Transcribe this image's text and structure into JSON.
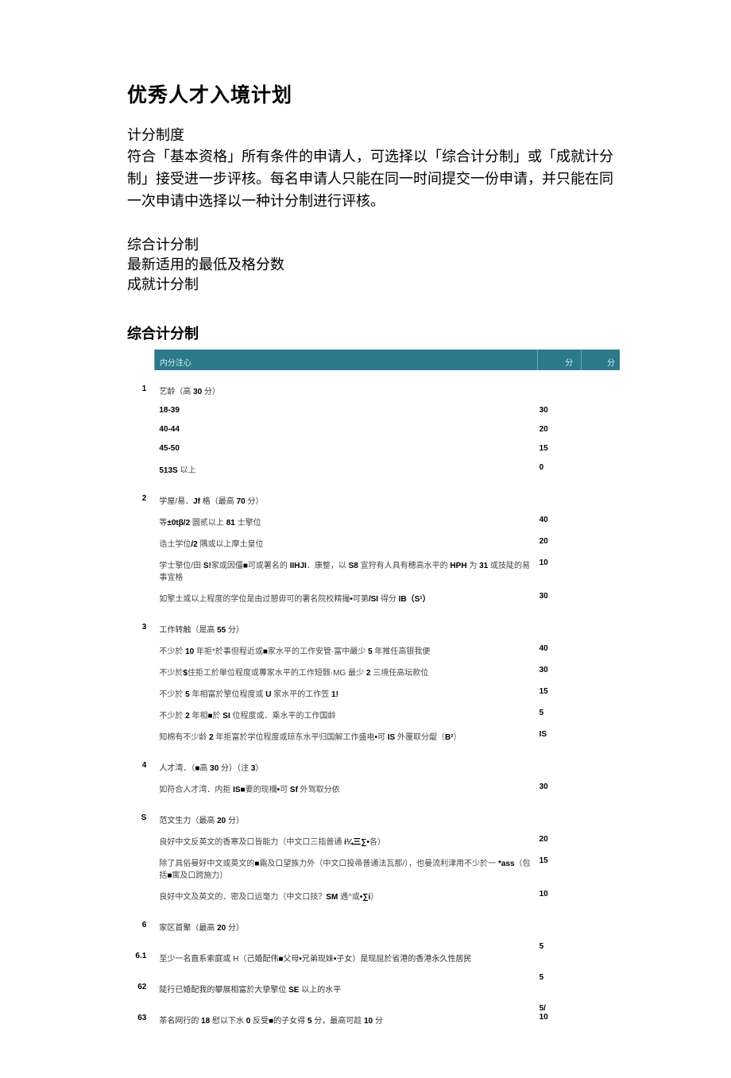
{
  "title": "优秀人才入境计划",
  "subtitle": "计分制度",
  "intro": "符合「基本资格」所有条件的申请人，可选择以「综合计分制」或「成就计分制」接受进一步评核。每名申请人只能在同一时间提交一份申请，并只能在同一次申请中选择以一种计分制进行评核。",
  "links": {
    "l1": "综合计分制",
    "l2": "最新适用的最低及格分数",
    "l3": "成就计分制"
  },
  "section_heading": "综合计分制",
  "table": {
    "header": {
      "content": "内分注心",
      "s1": "分",
      "s2": "分"
    },
    "rows": [
      {
        "num": "1",
        "content": "艺龄（高 <b>30</b> 分）",
        "score": ""
      },
      {
        "num": "",
        "content": "<b>18-39</b>",
        "score": "30"
      },
      {
        "num": "",
        "content": "<b>40-44</b>",
        "score": "20"
      },
      {
        "num": "",
        "content": "<b>45-50</b>",
        "score": "15"
      },
      {
        "num": "",
        "content": "<b>513S</b> 以上",
        "score": "0"
      },
      {
        "num": "2",
        "content": "学屋/易．<b>Jf</b> 格（最高 <b>70</b> 分）",
        "score": ""
      },
      {
        "num": "",
        "content": "等<b>±0tβ/2</b> 圜贰以上 <b>81</b> 士擎位",
        "score": "40"
      },
      {
        "num": "",
        "content": "诰土学位<b>/2</b> 隅或以上摩土皇位",
        "score": "20"
      },
      {
        "num": "",
        "content": "学士擎位/田 <b>S!</b>家或因僵<b>■</b>可或署名的 <b>IIHJI</b>．康整，以 <b>S8</b> 宣狩有人具有穂高水平的 <b>HPH</b> 为 <b>31</b> 或技陡的易事宜格",
        "score": "10"
      },
      {
        "num": "",
        "content": "如擎土或以上程度的学位是由过憩毋可的署名院校精撮<b>•</b>可第<b>/SI</b> 得分 <b>IB（S¹）</b>",
        "score": "30"
      },
      {
        "num": "3",
        "content": "工作转触（是高 <b>55</b> 分）",
        "score": ""
      },
      {
        "num": "",
        "content": "不少於 <b>10</b> 年拒*於事但程近或<b>■</b>家水平的工作安管·富中嚴少 <b>5</b> 年推任高银我便",
        "score": "40"
      },
      {
        "num": "",
        "content": "不少於<b>$</b>住拒工於単位程度或蓴家水平的工作短骸·MG 最少 <b>2</b> 三境任高坛款位",
        "score": "30"
      },
      {
        "num": "",
        "content": "不少於 <b>5</b> 年相富於擎位程度或 <b>U</b> 家水平的工作笠 <b>1!</b>",
        "score": "15"
      },
      {
        "num": "",
        "content": "不少於 <b>2</b> 年相<b>■</b>於 <b>SI</b> 位程度或．乘水平的工作国龄",
        "score": "5"
      },
      {
        "num": "",
        "content": "知棉有不少龄 <b>2</b> 年拒富於学位程度或琼东水平归国解工作盛电<b>•</b>可 <b>IS</b> 外覆取分龊（<b>B²</b>）",
        "score": "IS"
      },
      {
        "num": "4",
        "content": "人才湾．（<b>■</b>高 <b>30</b> 分）（注 <b>3</b>）",
        "score": ""
      },
      {
        "num": "",
        "content": "如符合人才湾．内拒 <b>IS■</b>要的现檷<b>•</b>可 <b>Sf</b> 外驾取分依",
        "score": "30"
      },
      {
        "num": "S",
        "content": "范文生力（最高 <b>20</b> 分）",
        "score": ""
      },
      {
        "num": "",
        "content": "良好中文反英文的香寒及口皆能力（中文口三指普通 <b>i¼三∑•</b>各）",
        "score": "20"
      },
      {
        "num": "",
        "content": "除了具俗曼好中文或英文的<b>■</b>霜及口望族力外（中文口投帚普通法瓦那/），也曼流利津用不少於一 <b>*ass</b>（包括<b>■</b>寓及口跨施力）",
        "score": "15"
      },
      {
        "num": "",
        "content": "良好中文及英文的．密及口运毫力（中文口技？<b>SM</b> 遇^或<b>•∑i</b>）",
        "score": "10"
      },
      {
        "num": "6",
        "content": "家区首聚（最高 <b>20</b> 分）",
        "score": ""
      },
      {
        "num": "6.1",
        "content": "至少一名直系索庭或 H（己婚配伟<b>■</b>父母<b>•</b>兄弟现妹<b>•</b>子女）是现屈於省港的香港永久性居民",
        "score": "5"
      },
      {
        "num": "62",
        "content": "陡行已婚配我的攀展相富於大挚擎位 <b>SE</b> 以上的水平",
        "score": "5"
      },
      {
        "num": "63",
        "content": "茶名网行的 <b>18</b> 慰以下水 <b>0</b> 反受<b>■</b>的子女得 <b>5</b> 分，最高可趁 <b>10</b> 分",
        "score": "5/10"
      }
    ]
  }
}
